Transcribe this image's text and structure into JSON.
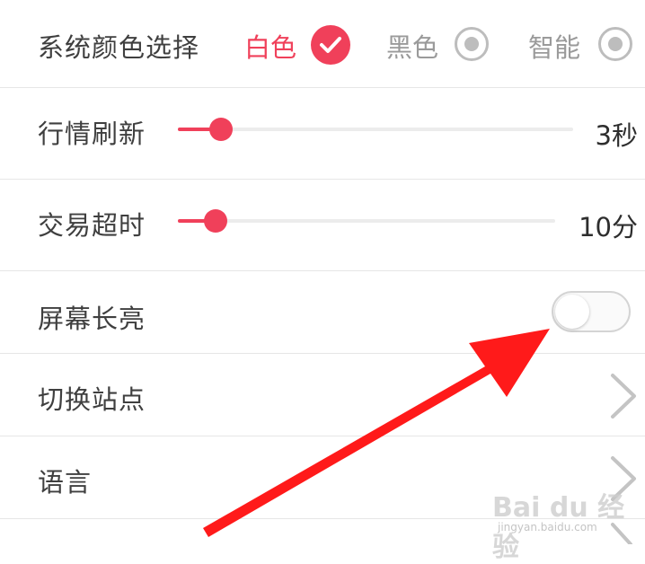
{
  "settings": {
    "color_theme": {
      "label": "系统颜色选择",
      "options": [
        {
          "label": "白色",
          "selected": true
        },
        {
          "label": "黑色",
          "selected": false
        },
        {
          "label": "智能",
          "selected": false
        }
      ]
    },
    "refresh": {
      "label": "行情刷新",
      "value_text": "3秒",
      "slider_fraction": 0.11
    },
    "timeout": {
      "label": "交易超时",
      "value_text": "10分",
      "slider_fraction": 0.1
    },
    "screen_on": {
      "label": "屏幕长亮",
      "enabled": false
    },
    "switch_site": {
      "label": "切换站点"
    },
    "language": {
      "label": "语言"
    }
  },
  "colors": {
    "accent": "#f0405a",
    "annotation_arrow": "#ff1a1a"
  },
  "icons": {
    "selected": "check-icon",
    "nav": "chevron-right-icon"
  },
  "watermark": {
    "brand": "Bai du 经验",
    "url": "jingyan.baidu.com"
  }
}
